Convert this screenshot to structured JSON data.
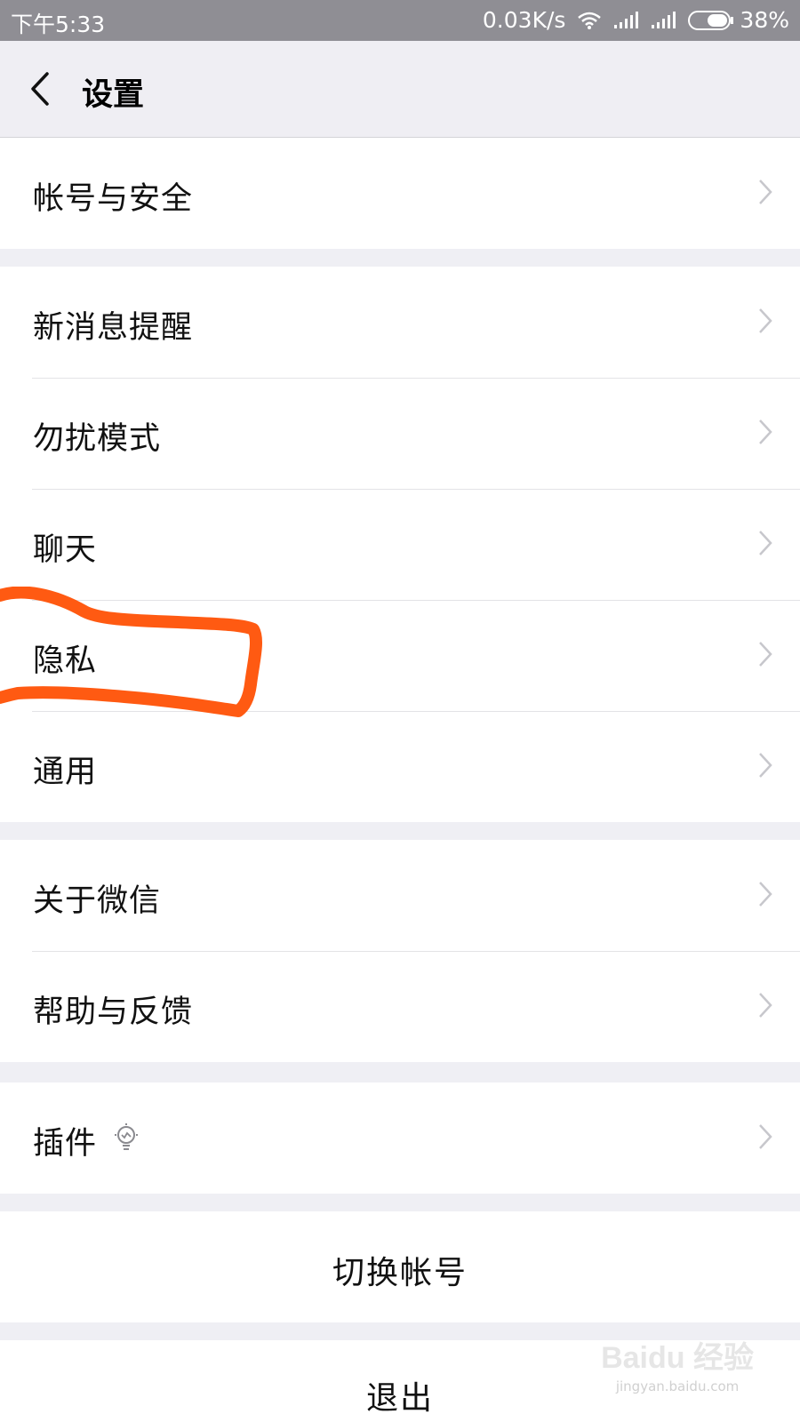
{
  "status_bar": {
    "time": "下午5:33",
    "speed": "0.03K/s",
    "battery": "38%"
  },
  "header": {
    "title": "设置"
  },
  "groups": [
    {
      "items": [
        {
          "label": "帐号与安全"
        }
      ]
    },
    {
      "items": [
        {
          "label": "新消息提醒"
        },
        {
          "label": "勿扰模式"
        },
        {
          "label": "聊天"
        },
        {
          "label": "隐私"
        },
        {
          "label": "通用"
        }
      ]
    },
    {
      "items": [
        {
          "label": "关于微信"
        },
        {
          "label": "帮助与反馈"
        }
      ]
    },
    {
      "items": [
        {
          "label": "插件"
        }
      ]
    }
  ],
  "actions": {
    "switch_account": "切换帐号",
    "logout": "退出"
  },
  "watermark": {
    "brand": "Baidu 经验",
    "url": "jingyan.baidu.com"
  },
  "colors": {
    "annotation": "#ff5a12",
    "background": "#efeff4"
  }
}
